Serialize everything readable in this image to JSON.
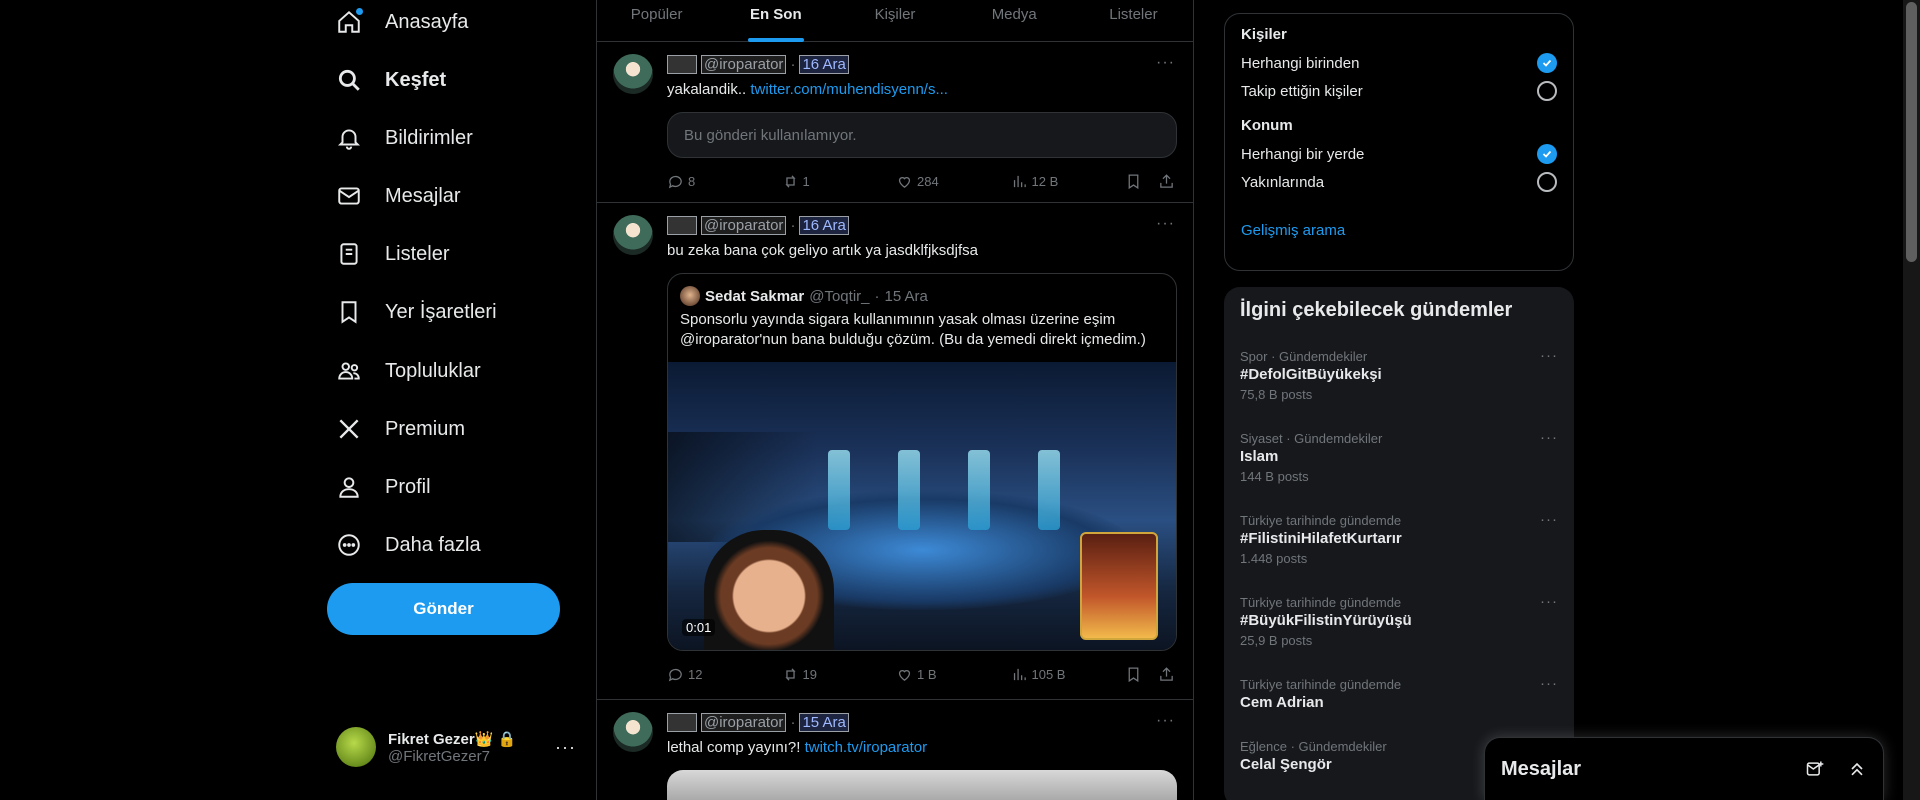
{
  "nav": {
    "items": [
      {
        "key": "home",
        "label": "Anasayfa",
        "icon": "home-icon"
      },
      {
        "key": "explore",
        "label": "Keşfet",
        "icon": "search-icon"
      },
      {
        "key": "notifications",
        "label": "Bildirimler",
        "icon": "bell-icon"
      },
      {
        "key": "messages",
        "label": "Mesajlar",
        "icon": "envelope-icon"
      },
      {
        "key": "lists",
        "label": "Listeler",
        "icon": "list-icon"
      },
      {
        "key": "bookmarks",
        "label": "Yer İşaretleri",
        "icon": "bookmark-icon"
      },
      {
        "key": "communities",
        "label": "Topluluklar",
        "icon": "people-icon"
      },
      {
        "key": "premium",
        "label": "Premium",
        "icon": "x-logo-icon"
      },
      {
        "key": "profile",
        "label": "Profil",
        "icon": "person-icon"
      },
      {
        "key": "more",
        "label": "Daha fazla",
        "icon": "more-circle-icon"
      }
    ],
    "post_button": "Gönder"
  },
  "account": {
    "name": "Fikret Gezer👑",
    "handle": "@FikretGezer7"
  },
  "tabs": [
    "Popüler",
    "En Son",
    "Kişiler",
    "Medya",
    "Listeler"
  ],
  "active_tab": "En Son",
  "tweets": [
    {
      "handle": "@iroparator",
      "date": "16 Ara",
      "text": "yakalandik..",
      "link": "twitter.com/muhendisyenn/s...",
      "unavailable": "Bu gönderi kullanılamıyor.",
      "replies": "8",
      "retweets": "1",
      "likes": "284",
      "views": "12 B"
    },
    {
      "handle": "@iroparator",
      "date": "16 Ara",
      "text": "bu zeka bana çok geliyo artık ya jasdklfjksdjfsa",
      "quote": {
        "name": "Sedat Sakmar",
        "handle": "@Toqtir_",
        "date": "15 Ara",
        "text": "Sponsorlu yayında sigara kullanımının yasak olması üzerine eşim @iroparator'nun bana bulduğu çözüm. (Bu da yemedi direkt içmedim.)",
        "video_time": "0:01"
      },
      "replies": "12",
      "retweets": "19",
      "likes": "1 B",
      "views": "105 B"
    },
    {
      "handle": "@iroparator",
      "date": "15 Ara",
      "text": "lethal comp yayını?!",
      "link": "twitch.tv/iroparator"
    }
  ],
  "filters": {
    "people_title": "Kişiler",
    "people_options": [
      "Herhangi birinden",
      "Takip ettiğin kişiler"
    ],
    "location_title": "Konum",
    "location_options": [
      "Herhangi bir yerde",
      "Yakınlarında"
    ],
    "advanced": "Gelişmiş arama"
  },
  "trends": {
    "title": "İlgini çekebilecek gündemler",
    "items": [
      {
        "category": "Spor · Gündemdekiler",
        "name": "#DefolGitBüyükekşi",
        "count": "75,8 B posts"
      },
      {
        "category": "Siyaset · Gündemdekiler",
        "name": "Islam",
        "count": "144 B posts"
      },
      {
        "category": "Türkiye tarihinde gündemde",
        "name": "#FilistiniHilafetKurtarır",
        "count": "1.448 posts"
      },
      {
        "category": "Türkiye tarihinde gündemde",
        "name": "#BüyükFilistinYürüyüşü",
        "count": "25,9 B posts"
      },
      {
        "category": "Türkiye tarihinde gündemde",
        "name": "Cem Adrian",
        "count": ""
      },
      {
        "category": "Eğlence · Gündemdekiler",
        "name": "Celal Şengör",
        "count": ""
      }
    ]
  },
  "drawer": {
    "title": "Mesajlar"
  },
  "colors": {
    "accent": "#1d9bf0",
    "background": "#000000",
    "border": "#2f3336",
    "muted": "#71767b"
  }
}
